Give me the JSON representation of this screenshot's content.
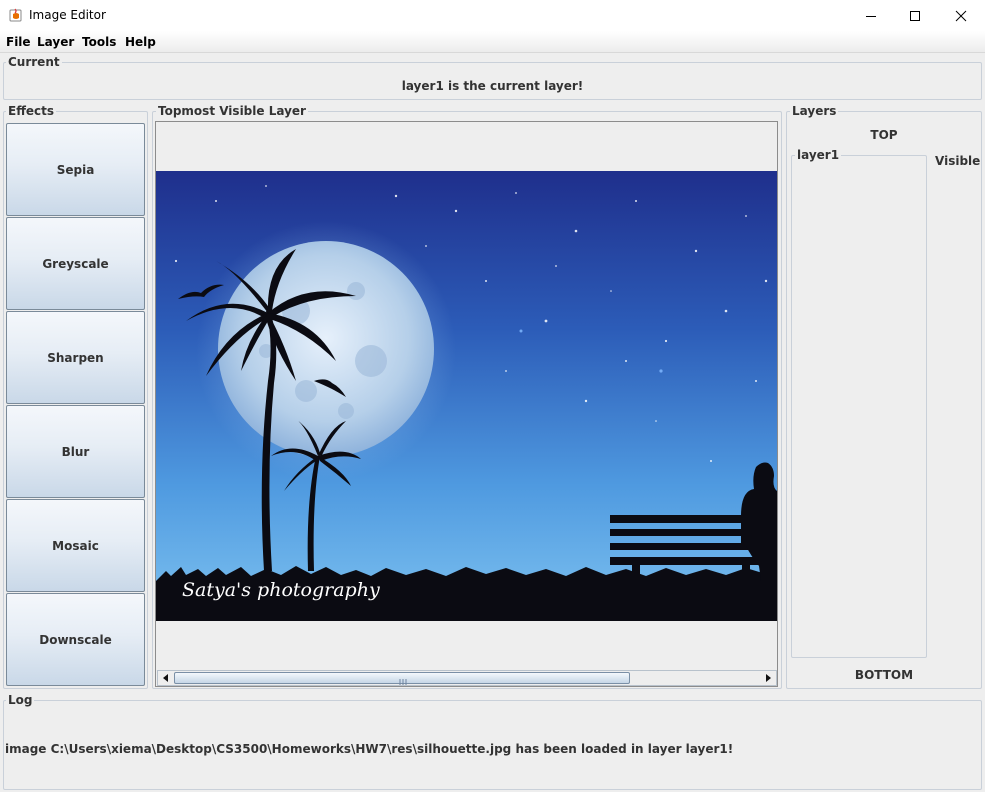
{
  "window": {
    "title": "Image Editor"
  },
  "menu": {
    "items": [
      "File",
      "Layer",
      "Tools",
      "Help"
    ]
  },
  "current": {
    "legend": "Current",
    "message": "layer1 is the current layer!"
  },
  "effects": {
    "legend": "Effects",
    "buttons": [
      "Sepia",
      "Greyscale",
      "Sharpen",
      "Blur",
      "Mosaic",
      "Downscale"
    ]
  },
  "view": {
    "legend": "Topmost Visible Layer",
    "watermark": "Satya's photography"
  },
  "layers": {
    "legend": "Layers",
    "top_label": "TOP",
    "bottom_label": "BOTTOM",
    "layer_name": "layer1",
    "visible_label": "Visible"
  },
  "log": {
    "legend": "Log",
    "message": "image C:\\Users\\xiema\\Desktop\\CS3500\\Homeworks\\HW7\\res\\silhouette.jpg has been loaded in layer layer1!"
  },
  "colors": {
    "sky_top": "#1e2d8a",
    "sky_bottom": "#6fb8ee",
    "silhouette": "#0b0b12",
    "button_top": "#f4f7fb",
    "button_bottom": "#c9d8e8"
  }
}
